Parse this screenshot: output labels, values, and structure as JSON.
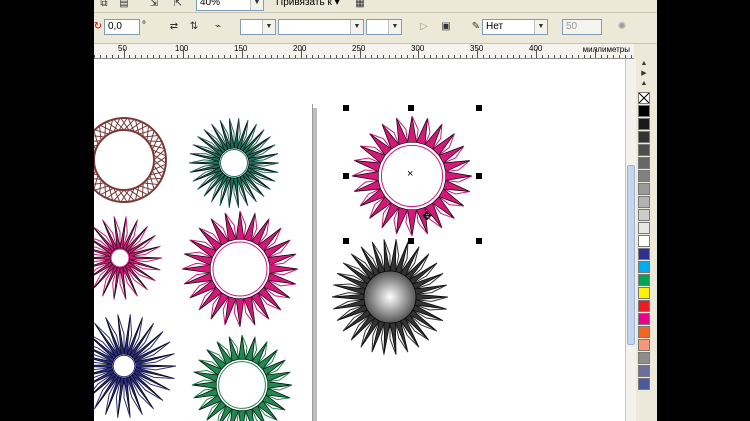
{
  "toolbar_top": {
    "zoom_value": "40%",
    "snap_label": "Привязать к"
  },
  "property_bar": {
    "rotation_value": "0,0",
    "rotation_unit": "°",
    "fill_value": "Нет",
    "nodes_value": "50"
  },
  "ruler": {
    "ticks": [
      "50",
      "100",
      "150",
      "200",
      "250",
      "300",
      "350",
      "400"
    ],
    "units": "миллиметры"
  },
  "palette": {
    "colors": [
      "#000000",
      "#1a1a1a",
      "#333333",
      "#4d4d4d",
      "#666666",
      "#808080",
      "#999999",
      "#b3b3b3",
      "#cccccc",
      "#e6e6e6",
      "#ffffff",
      "#2e3192",
      "#00aeef",
      "#00a651",
      "#fff200",
      "#ed1c24",
      "#ec008c",
      "#f26522",
      "#f7977a",
      "#8c8c8c",
      "#6d6e9a",
      "#4b5aa0"
    ]
  },
  "shapes": {
    "colors": {
      "brown": "#7a3a3a",
      "teal": "#1e6f5c",
      "magenta": "#d4187a",
      "navy": "#2b2e82",
      "green": "#1f8a50",
      "gray": "#333333"
    }
  }
}
